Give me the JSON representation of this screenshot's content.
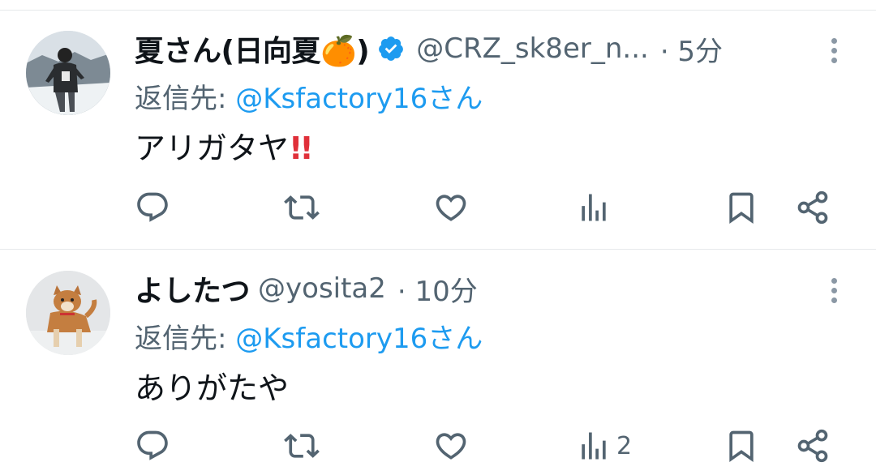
{
  "tweets": [
    {
      "display_name": "夏さん(日向夏",
      "name_emoji": "🍊",
      "name_close": ")",
      "verified": true,
      "handle": "@CRZ_sk8er_n...",
      "time": "· 5分",
      "reply_prefix": "返信先: ",
      "reply_handle": "@Ksfactory16さん",
      "text": "アリガタヤ",
      "text_emoji": "!!",
      "stats": {
        "views": ""
      }
    },
    {
      "display_name": "よしたつ",
      "handle": "@yosita2",
      "time": "· 10分",
      "reply_prefix": "返信先: ",
      "reply_handle": "@Ksfactory16さん",
      "text": "ありがたや",
      "stats": {
        "views": "2"
      }
    }
  ],
  "icons": [
    "reply-icon",
    "retweet-icon",
    "like-icon",
    "views-icon",
    "bookmark-icon",
    "share-icon",
    "more-icon",
    "verified-badge-icon"
  ],
  "colors": {
    "accent": "#1d9bf0",
    "secondary_text": "#536471",
    "divider": "#e6e9eb",
    "primary_text": "#0f1419"
  }
}
